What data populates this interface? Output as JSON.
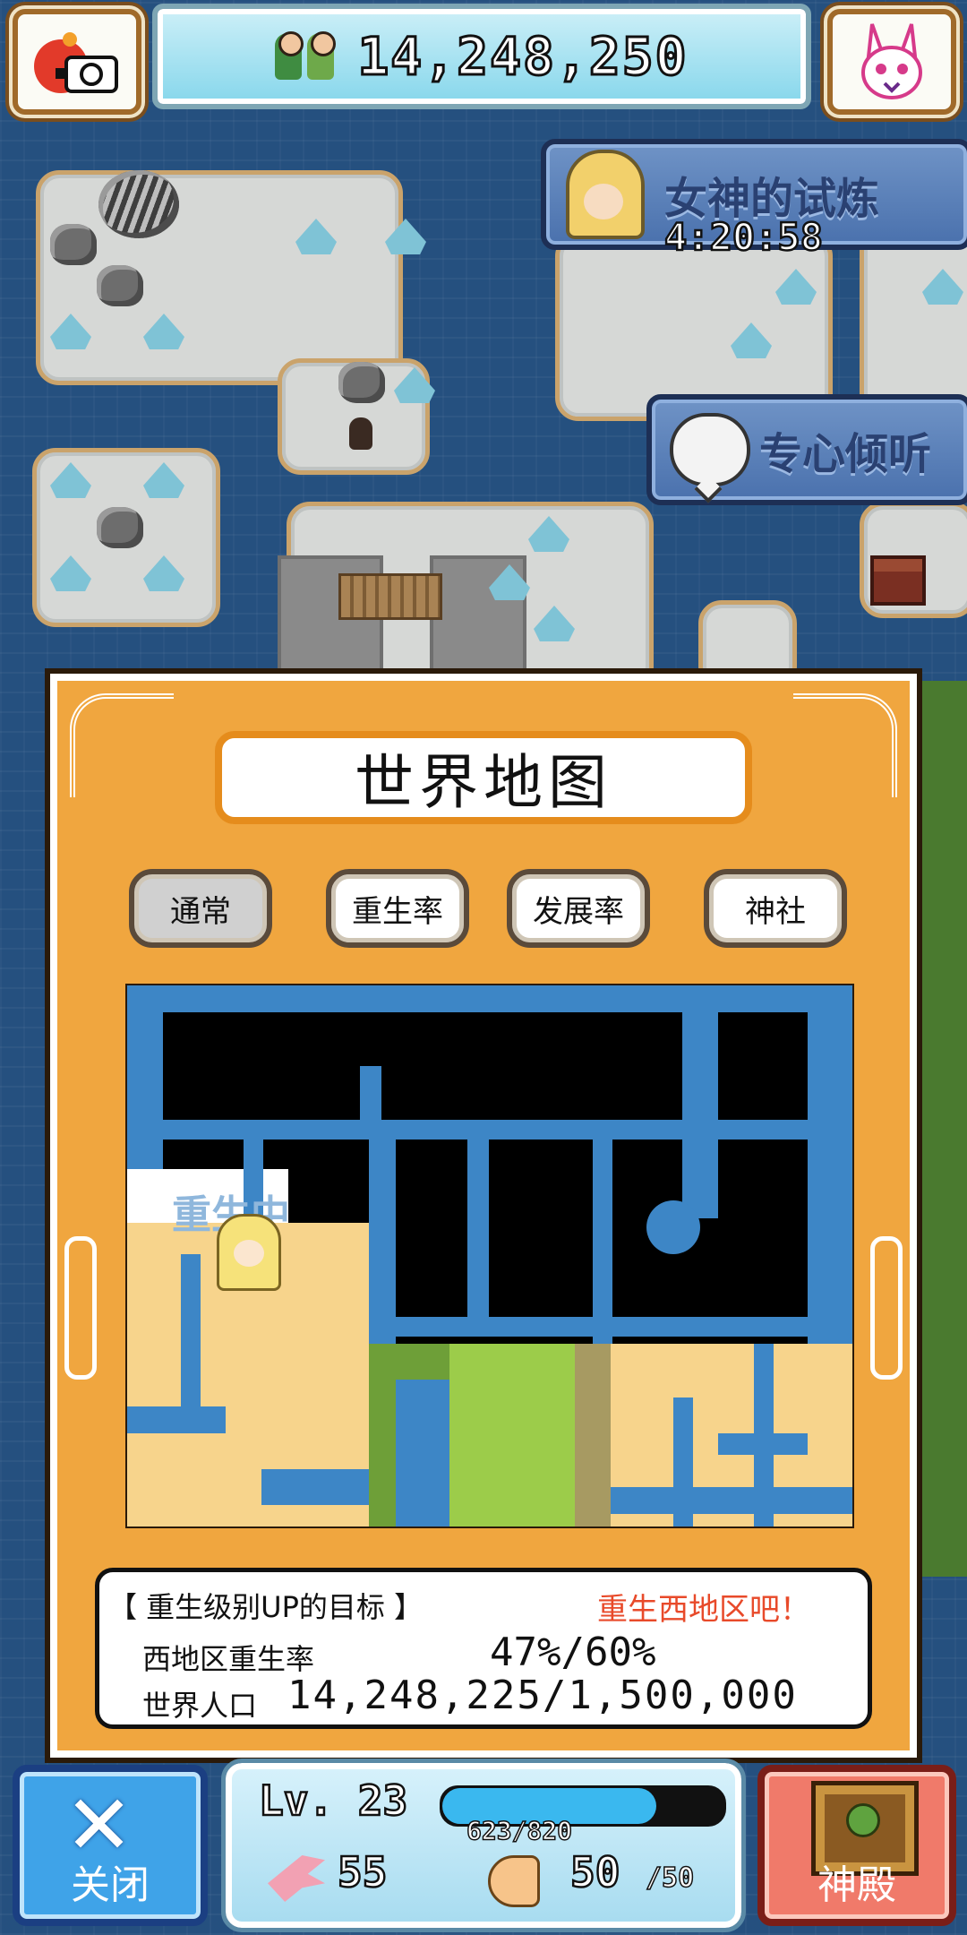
{
  "hud": {
    "population": "14,248,250",
    "colors": {
      "accent": "#f0a63f",
      "water": "#25507f"
    }
  },
  "banners": {
    "goddess_trial": "女神的试炼",
    "goddess_timer": "4:20:58",
    "listen": "专心倾听"
  },
  "modal": {
    "title": "世界地图",
    "tabs": [
      {
        "label": "通常",
        "active": true
      },
      {
        "label": "重生率",
        "active": false
      },
      {
        "label": "发展率",
        "active": false
      },
      {
        "label": "神社",
        "active": false
      }
    ],
    "map_label": "重生中",
    "goal_title": "【 重生级别UP的目标 】",
    "goal_action": "重生西地区吧！",
    "rebirth_rate_label": "西地区重生率",
    "rebirth_rate_value": "47%/60%",
    "world_pop_label": "世界人口",
    "world_pop_value": "14,248,225/1,500,000"
  },
  "bottom": {
    "close_label": "关闭",
    "temple_label": "神殿",
    "level": "Lv. 23",
    "xp_text": "623/820",
    "xp_fraction": 0.76,
    "power": "55",
    "stamina": "50",
    "stamina_max": "/50"
  },
  "icons": [
    "camera-icon",
    "bunny-mascot-icon",
    "people-icon",
    "goddess-icon",
    "speech-bubble-icon",
    "close-x-icon",
    "temple-icon",
    "hand-icon",
    "arm-icon"
  ]
}
